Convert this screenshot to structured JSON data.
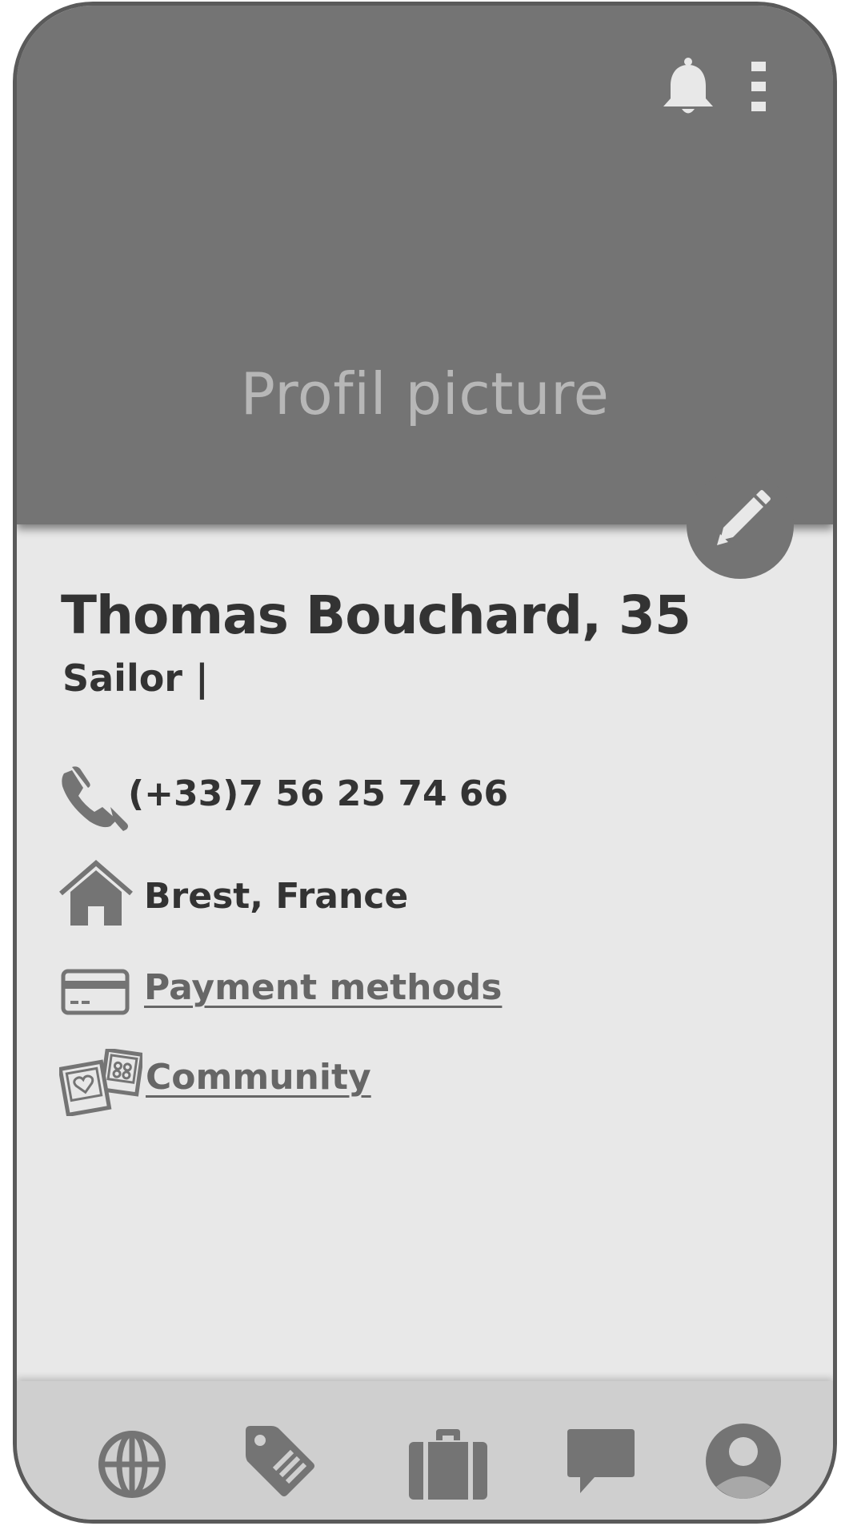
{
  "header": {
    "title": "Profil picture",
    "icons": [
      "bell-icon",
      "kebab-menu-icon"
    ]
  },
  "profile": {
    "name_line": "Thomas Bouchard, 35",
    "occupation": "Sailor |"
  },
  "details": {
    "phone": "(+33)7 56 25 74 66",
    "location": "Brest, France",
    "payment_link": "Payment methods",
    "community_link": "Community"
  },
  "actions": {
    "edit_icon": "pencil-icon"
  },
  "bottom_nav": {
    "items": [
      "globe-icon",
      "tag-icon",
      "briefcase-icon",
      "chat-icon",
      "avatar-icon"
    ]
  },
  "colors": {
    "header_bg": "#747474",
    "content_bg": "#e8e8e8",
    "nav_bg": "#cfcfcf",
    "text_dark": "#333333",
    "link_gray": "#666666"
  }
}
